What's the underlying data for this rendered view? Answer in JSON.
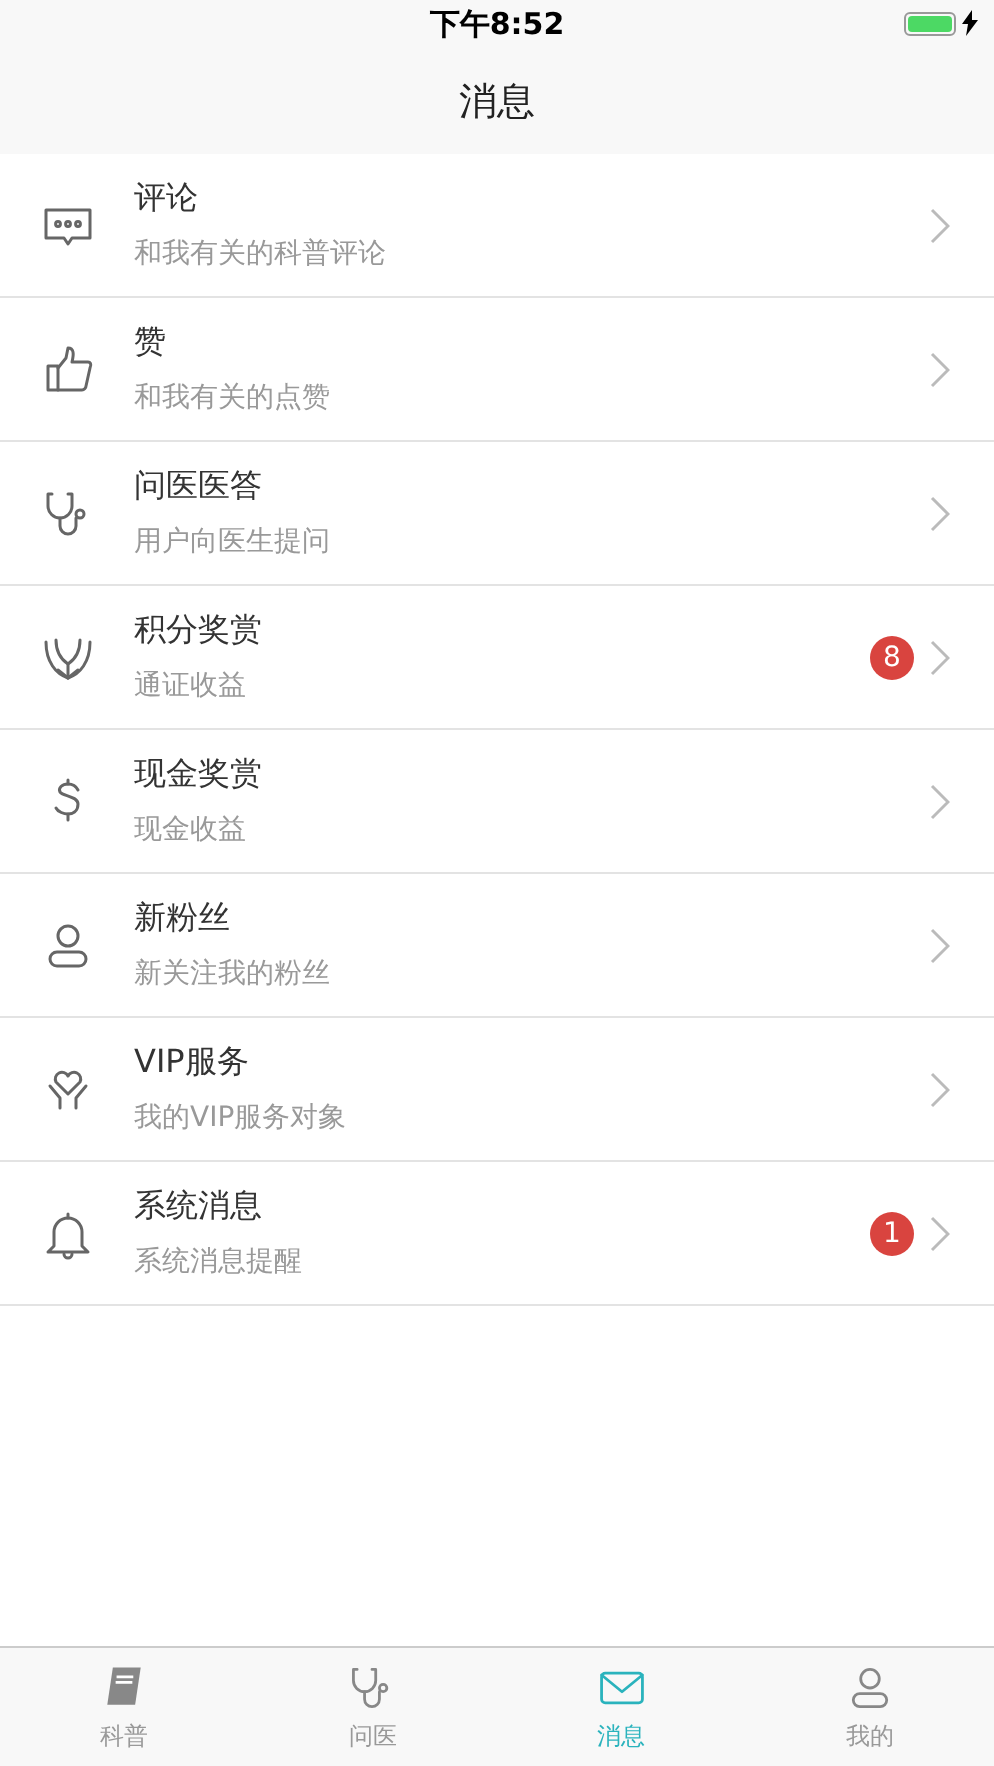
{
  "status_bar": {
    "time": "下午8:52"
  },
  "nav_bar": {
    "title": "消息"
  },
  "items": [
    {
      "kind": "comment",
      "title": "评论",
      "subtitle": "和我有关的科普评论"
    },
    {
      "kind": "like",
      "title": "赞",
      "subtitle": "和我有关的点赞"
    },
    {
      "kind": "stethoscope",
      "title": "问医医答",
      "subtitle": "用户向医生提问"
    },
    {
      "kind": "lotus",
      "title": "积分奖赏",
      "subtitle": "通证收益",
      "badge": "8"
    },
    {
      "kind": "dollar",
      "title": "现金奖赏",
      "subtitle": "现金收益"
    },
    {
      "kind": "person",
      "title": "新粉丝",
      "subtitle": "新关注我的粉丝"
    },
    {
      "kind": "heart",
      "title": "VIP服务",
      "subtitle": "我的VIP服务对象"
    },
    {
      "kind": "bell",
      "title": "系统消息",
      "subtitle": "系统消息提醒",
      "badge": "1"
    }
  ],
  "tab_bar": [
    {
      "kind": "book",
      "label": "科普",
      "selected": false
    },
    {
      "kind": "stethoscope",
      "label": "问医",
      "selected": false
    },
    {
      "kind": "mail",
      "label": "消息",
      "selected": true
    },
    {
      "kind": "person",
      "label": "我的",
      "selected": false
    }
  ]
}
